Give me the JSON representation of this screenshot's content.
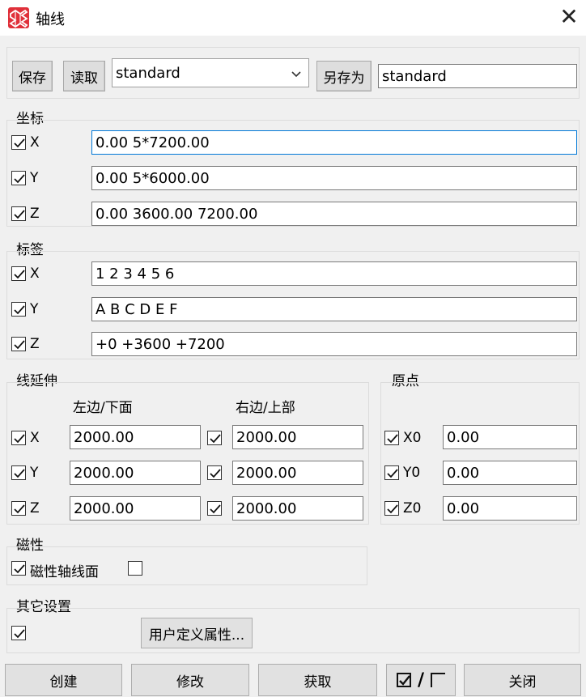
{
  "window": {
    "title": "轴线",
    "close_glyph": "✕"
  },
  "toolbar": {
    "save_label": "保存",
    "load_label": "读取",
    "template_select": "standard",
    "save_as_label": "另存为",
    "save_as_name": "standard"
  },
  "coords": {
    "group_label": "坐标",
    "x_label": "X",
    "x_value": "0.00 5*7200.00",
    "y_label": "Y",
    "y_value": "0.00 5*6000.00",
    "z_label": "Z",
    "z_value": "0.00 3600.00 7200.00"
  },
  "labels": {
    "group_label": "标签",
    "x_label": "X",
    "x_value": "1 2 3 4 5 6",
    "y_label": "Y",
    "y_value": "A B C D E F",
    "z_label": "Z",
    "z_value": "+0 +3600 +7200"
  },
  "extension": {
    "group_label": "线延伸",
    "left_header": "左边/下面",
    "right_header": "右边/上部",
    "x_label": "X",
    "x_left": "2000.00",
    "x_right": "2000.00",
    "y_label": "Y",
    "y_left": "2000.00",
    "y_right": "2000.00",
    "z_label": "Z",
    "z_left": "2000.00",
    "z_right": "2000.00"
  },
  "origin": {
    "group_label": "原点",
    "x0_label": "X0",
    "x0_value": "0.00",
    "y0_label": "Y0",
    "y0_value": "0.00",
    "z0_label": "Z0",
    "z0_value": "0.00"
  },
  "magnetic": {
    "group_label": "磁性",
    "plane_label": "磁性轴线面"
  },
  "other": {
    "group_label": "其它设置",
    "user_attr_label": "用户定义属性..."
  },
  "footer": {
    "create_label": "创建",
    "modify_label": "修改",
    "get_label": "获取",
    "toggle_slash": "/",
    "close_label": "关闭"
  }
}
